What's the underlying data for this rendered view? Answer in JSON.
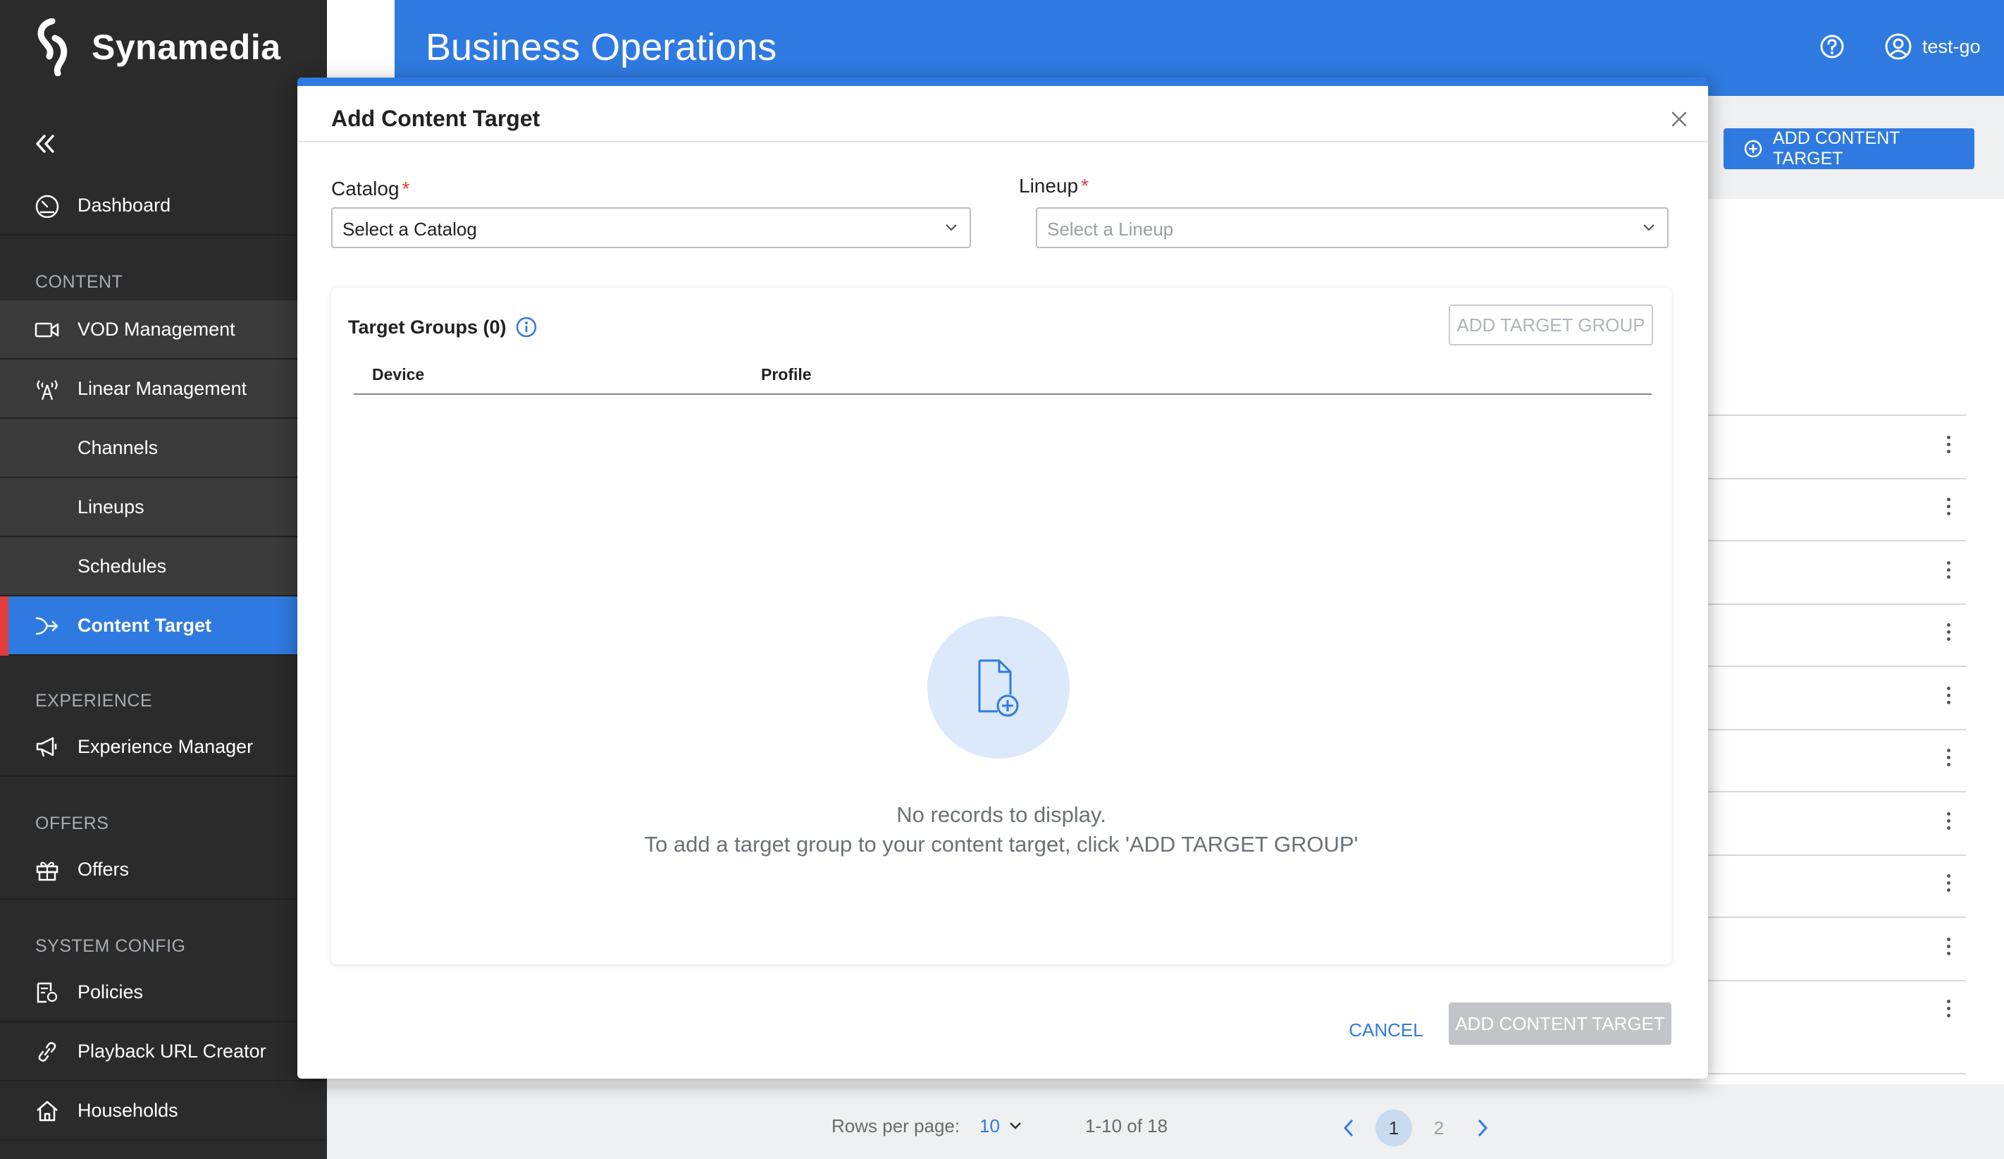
{
  "app": {
    "brand": "Synamedia",
    "page_title": "Business Operations",
    "user": "test-go"
  },
  "sidebar": {
    "dashboard": "Dashboard",
    "section_content": "CONTENT",
    "vod": "VOD Management",
    "linear": "Linear Management",
    "channels": "Channels",
    "lineups": "Lineups",
    "schedules": "Schedules",
    "content_target": "Content Target",
    "section_experience": "EXPERIENCE",
    "experience_manager": "Experience Manager",
    "section_offers": "OFFERS",
    "offers": "Offers",
    "section_system": "SYSTEM CONFIG",
    "policies": "Policies",
    "playback_url": "Playback URL Creator",
    "households": "Households"
  },
  "background": {
    "add_button": "ADD CONTENT TARGET",
    "rows_per_page_label": "Rows per page:",
    "rows_per_page_value": "10",
    "range": "1-10 of 18",
    "pages": [
      "1",
      "2"
    ],
    "current_page": "1"
  },
  "modal": {
    "title": "Add Content Target",
    "catalog_label": "Catalog",
    "catalog_value": "Select a Catalog",
    "lineup_label": "Lineup",
    "lineup_placeholder": "Select a Lineup",
    "required_mark": "*",
    "target_groups_title": "Target Groups (0)",
    "add_target_group": "ADD TARGET GROUP",
    "columns": [
      "Device",
      "Profile"
    ],
    "empty_line1": "No records to display.",
    "empty_line2": "To add a target group to your content target, click 'ADD TARGET GROUP'",
    "cancel": "CANCEL",
    "submit": "ADD CONTENT TARGET"
  },
  "colors": {
    "accent": "#2f7ae0",
    "sidebar_bg": "#2b2b2b",
    "active_marker": "#e23d3d",
    "disabled_button": "#c2c4c7"
  }
}
